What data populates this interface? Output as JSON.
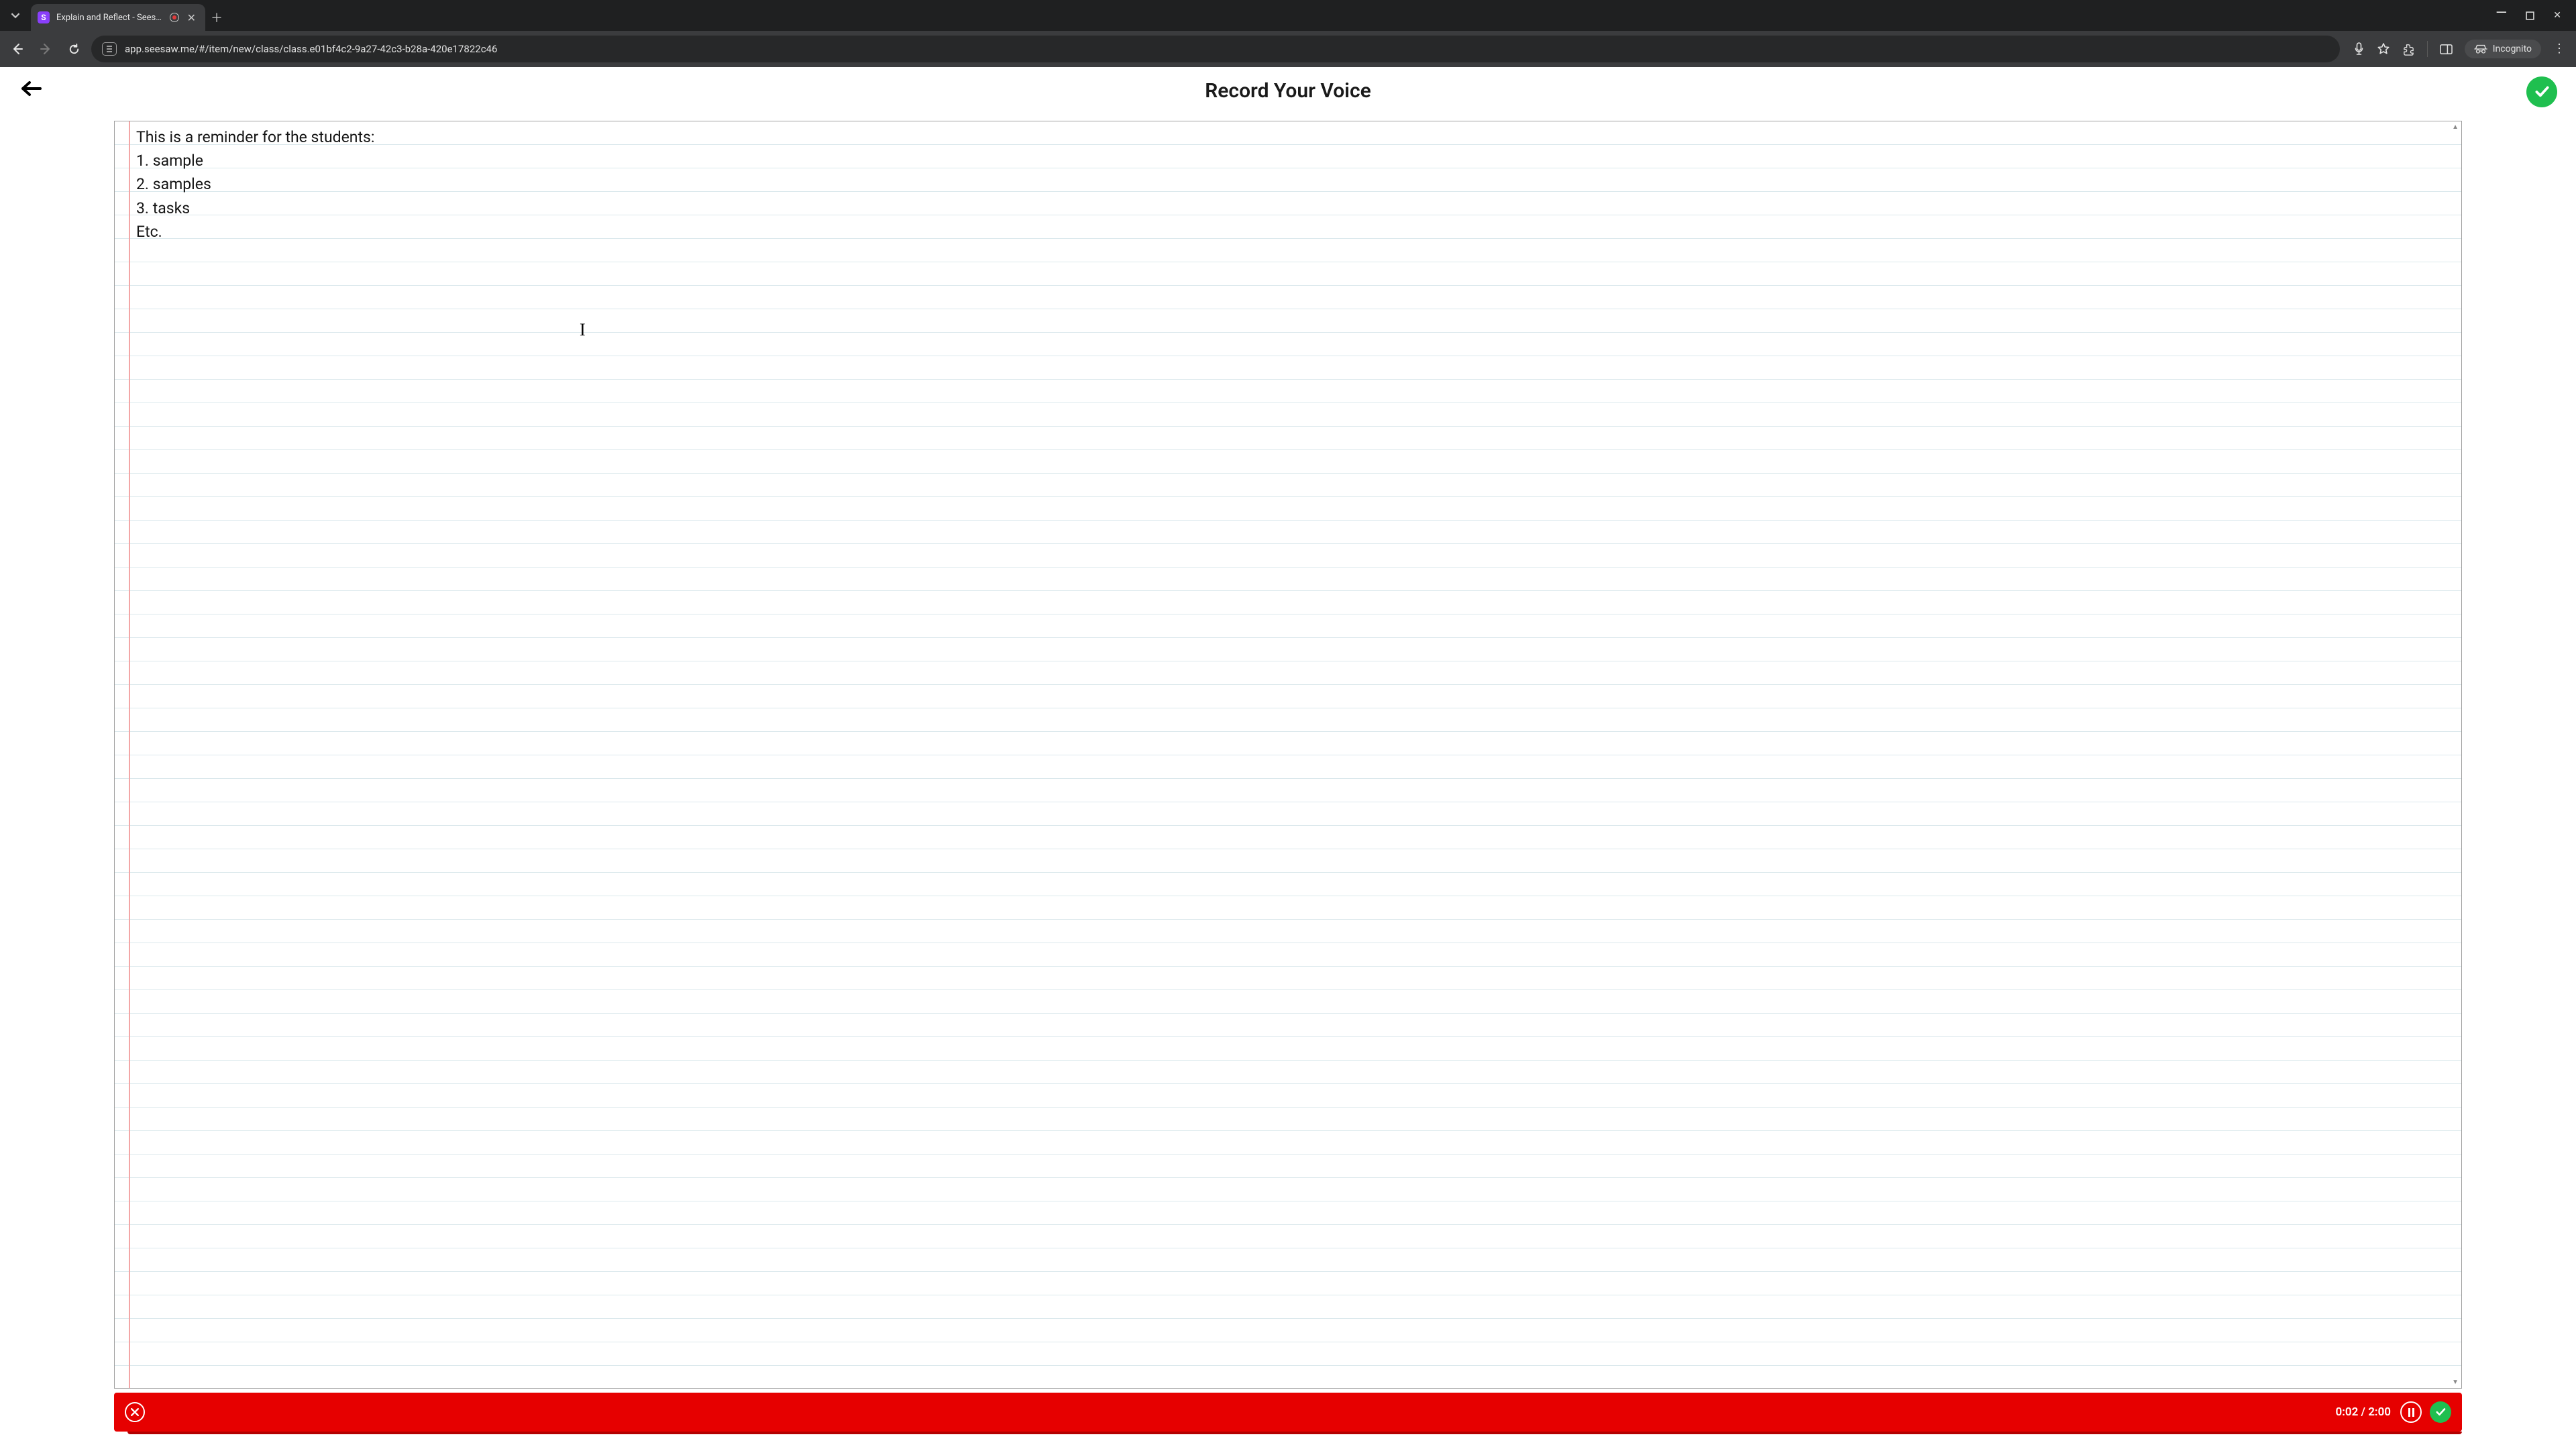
{
  "browser": {
    "tab": {
      "title": "Explain and Reflect - Seesaw",
      "favicon_letter": "S"
    },
    "url": "app.seesaw.me/#/item/new/class/class.e01bf4c2-9a27-42c3-b28a-420e17822c46",
    "incognito_label": "Incognito"
  },
  "page": {
    "title": "Record Your Voice"
  },
  "note": {
    "lines": [
      "This is a reminder for the students:",
      "1. sample",
      "2. samples",
      "3. tasks",
      "Etc."
    ]
  },
  "recording": {
    "elapsed": "0:02",
    "total": "2:00"
  }
}
